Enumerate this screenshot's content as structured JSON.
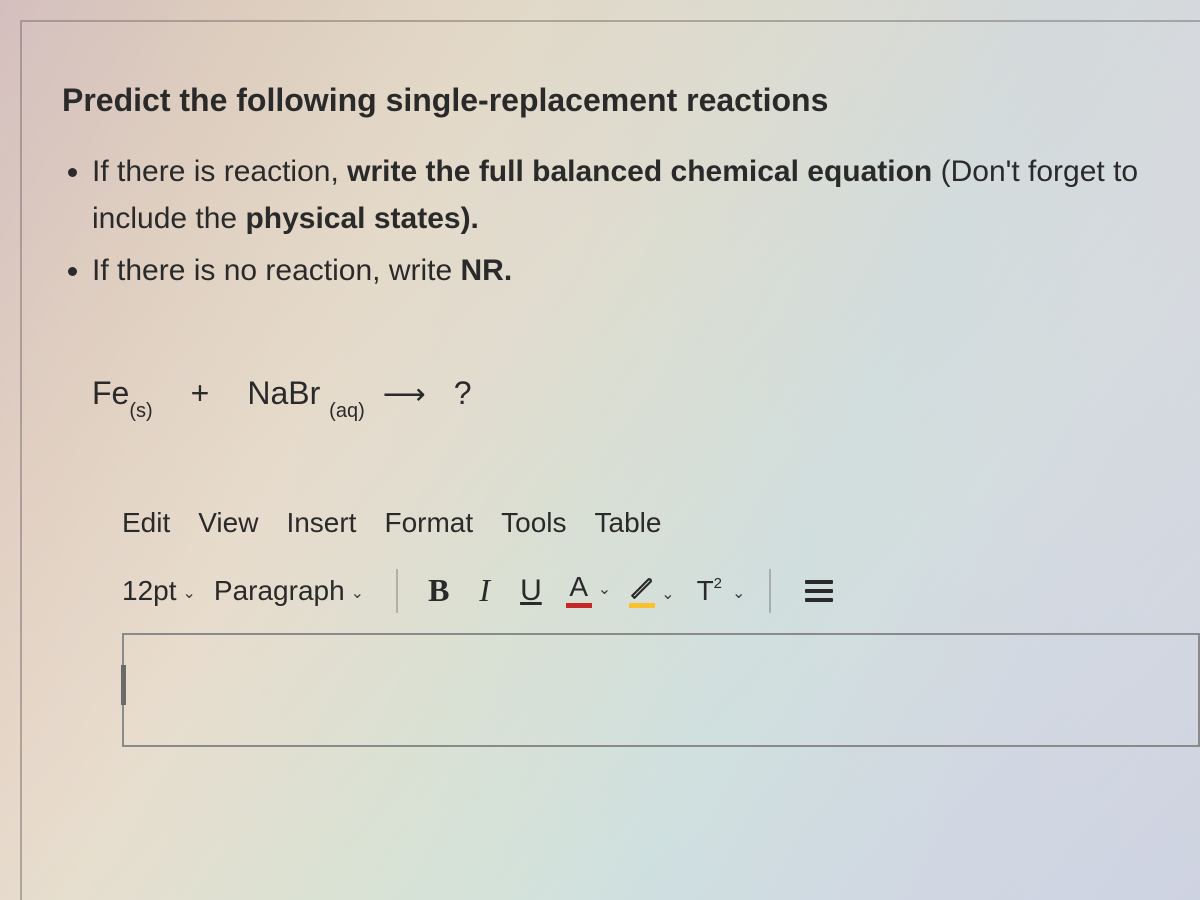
{
  "question": {
    "title": "Predict the following single-replacement reactions",
    "bullets": [
      {
        "pre": "If there is reaction, ",
        "bold1": "write the full balanced chemical equation",
        "mid": "  (Don't forget to include the ",
        "bold2": "physical states).",
        "post": ""
      },
      {
        "pre": "If there is no reaction, write ",
        "bold1": "NR.",
        "mid": "",
        "bold2": "",
        "post": ""
      }
    ],
    "equation": {
      "r1_base": "Fe",
      "r1_sub": "(s)",
      "plus": "+",
      "r2_base": "NaBr",
      "r2_sub": "(aq)",
      "arrow": "⟶",
      "product": "?"
    }
  },
  "editor": {
    "menus": [
      "Edit",
      "View",
      "Insert",
      "Format",
      "Tools",
      "Table"
    ],
    "font_size": "12pt",
    "block_style": "Paragraph",
    "buttons": {
      "bold": "B",
      "italic": "I",
      "underline": "U",
      "text_color_glyph": "A",
      "superscript_glyph": "T",
      "superscript_exp": "2"
    }
  }
}
